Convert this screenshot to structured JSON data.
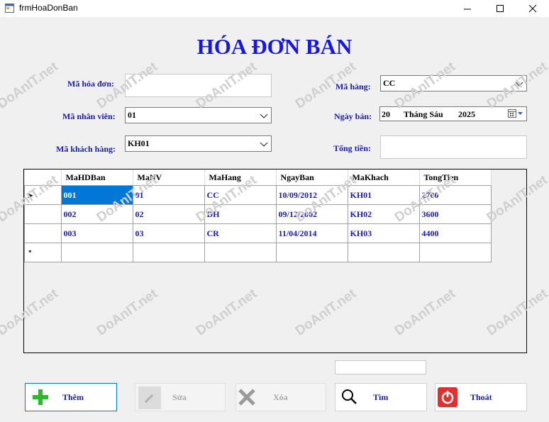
{
  "window": {
    "title": "frmHoaDonBan"
  },
  "heading": "HÓA ĐƠN BÁN",
  "form": {
    "ma_hoa_don_label": "Mã hóa đơn:",
    "ma_hoa_don_value": "",
    "ma_nhan_vien_label": "Mã nhân viên:",
    "ma_nhan_vien_value": "01",
    "ma_khach_hang_label": "Mã khách hàng:",
    "ma_khach_hang_value": "KH01",
    "ma_hang_label": "Mã hàng:",
    "ma_hang_value": "CC",
    "ngay_ban_label": "Ngày bán:",
    "ngay_ban_day": "20",
    "ngay_ban_month": "Tháng Sáu",
    "ngay_ban_year": "2025",
    "tong_tien_label": "Tổng tiền:",
    "tong_tien_value": ""
  },
  "grid": {
    "columns": [
      "MaHDBan",
      "MaNV",
      "MaHang",
      "NgayBan",
      "MaKhach",
      "TongTien"
    ],
    "rows": [
      [
        "001",
        "01",
        "CC",
        "10/09/2012",
        "KH01",
        "2700"
      ],
      [
        "002",
        "02",
        "DH",
        "09/12/2002",
        "KH02",
        "3600"
      ],
      [
        "003",
        "03",
        "CR",
        "11/04/2014",
        "KH03",
        "4400"
      ]
    ],
    "current_row_marker": "▸",
    "new_row_marker": "*"
  },
  "search_value": "",
  "buttons": {
    "them": "Thêm",
    "sua": "Sửa",
    "xoa": "Xóa",
    "tim": "Tìm",
    "thoat": "Thoát"
  },
  "watermark": "DoAnIT.net",
  "colors": {
    "label": "#1a1ab0",
    "heading": "#1818d8",
    "selection": "#0078d7",
    "add_icon": "#2eb82e",
    "exit_icon": "#e03030"
  }
}
